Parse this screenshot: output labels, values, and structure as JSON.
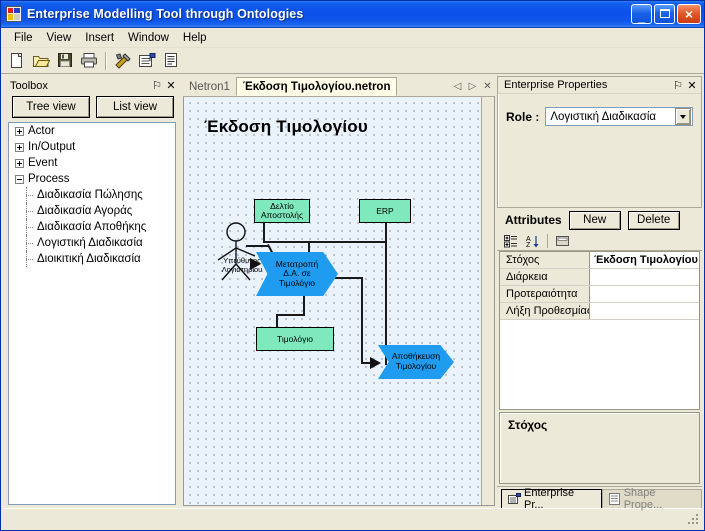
{
  "window": {
    "title": "Enterprise Modelling Tool through Ontologies",
    "icon": "app-icon",
    "minimize_label": "_",
    "maximize_label": "",
    "close_label": "×"
  },
  "menubar": {
    "items": [
      {
        "label": "File"
      },
      {
        "label": "View"
      },
      {
        "label": "Insert"
      },
      {
        "label": "Window"
      },
      {
        "label": "Help"
      }
    ]
  },
  "toolbar": {
    "buttons": [
      {
        "name": "new-file-icon",
        "tooltip": "New"
      },
      {
        "name": "open-folder-icon",
        "tooltip": "Open"
      },
      {
        "name": "save-disk-icon",
        "tooltip": "Save"
      },
      {
        "name": "print-icon",
        "tooltip": "Print"
      },
      {
        "name": "tools-icon",
        "tooltip": "Tools"
      },
      {
        "name": "properties-icon",
        "tooltip": "Properties"
      },
      {
        "name": "list-icon",
        "tooltip": "List"
      }
    ]
  },
  "toolbox": {
    "caption": "Toolbox",
    "pin_glyph": "⚐",
    "close_glyph": "✕",
    "tree_view_label": "Tree view",
    "list_view_label": "List view",
    "tree": [
      {
        "label": "Actor",
        "level": 0,
        "expanded": false
      },
      {
        "label": "In/Output",
        "level": 0,
        "expanded": false
      },
      {
        "label": "Event",
        "level": 0,
        "expanded": false
      },
      {
        "label": "Process",
        "level": 0,
        "expanded": true
      },
      {
        "label": "Διαδικασία Πώλησης",
        "level": 1
      },
      {
        "label": "Διαδικασία Αγοράς",
        "level": 1
      },
      {
        "label": "Διαδικασία Αποθήκης",
        "level": 1
      },
      {
        "label": "Λογιστική Διαδικασία",
        "level": 1
      },
      {
        "label": "Διοικιτική Διαδικασία",
        "level": 1
      }
    ]
  },
  "document": {
    "tabs": [
      {
        "label": "Netron1",
        "active": false
      },
      {
        "label": "Έκδοση Τιμολογίου.netron",
        "active": true
      }
    ],
    "nav_prev": "◁",
    "nav_next": "▷",
    "nav_close": "✕"
  },
  "diagram": {
    "title": "Έκδοση Τιμολογίου",
    "canvas_bg": "#eaf2fb",
    "box_fill": "#7fe8bd",
    "arrow_fill": "#1f9cf0",
    "actor_label": "Υπεύθυνος\nΛογιστηρίου",
    "actor_label_line1": "Υπεύθυνος",
    "actor_label_line2": "Λογιστηρίου",
    "nodes": [
      {
        "id": "deltio",
        "type": "box",
        "label": "Δελτίο\nΑποστολής"
      },
      {
        "id": "erp",
        "type": "box",
        "label": "ERP"
      },
      {
        "id": "metatropi",
        "type": "arrow",
        "label": "Μετατροπή\nΔ.Α. σε\nΤιμολόγιο"
      },
      {
        "id": "timologio",
        "type": "box",
        "label": "Τιμολόγιο"
      },
      {
        "id": "apothikeusi",
        "type": "arrow",
        "label": "Αποθήκευση\nΤιμολογίου"
      }
    ],
    "node_text": {
      "deltio_l1": "Δελτίο",
      "deltio_l2": "Αποστολής",
      "erp": "ERP",
      "metatropi_l1": "Μετατροπή",
      "metatropi_l2": "Δ.Α. σε",
      "metatropi_l3": "Τιμολόγιο",
      "timologio": "Τιμολόγιο",
      "apothikeusi_l1": "Αποθήκευση",
      "apothikeusi_l2": "Τιμολογίου"
    }
  },
  "properties": {
    "caption": "Enterprise Properties",
    "pin_glyph": "⚐",
    "close_glyph": "✕",
    "role_label": "Role :",
    "role_value": "Λογιστική Διαδικασία",
    "attributes_label": "Attributes",
    "new_button": "New",
    "delete_button": "Delete",
    "grid_toolbar": [
      {
        "name": "categorized-icon"
      },
      {
        "name": "sort-az-icon"
      },
      {
        "name": "property-pages-icon"
      }
    ],
    "rows": [
      {
        "name": "Στόχος",
        "value": "Έκδοση Τιμολογίου",
        "header": true
      },
      {
        "name": "Διάρκεια",
        "value": "",
        "header": false
      },
      {
        "name": "Προτεραιότητα",
        "value": "",
        "header": false
      },
      {
        "name": "Λήξη Προθεσμίας",
        "value": "",
        "header": false
      }
    ],
    "description_title": "Στόχος",
    "dock_tabs": [
      {
        "label": "Enterprise Pr...",
        "icon": "properties-icon",
        "active": true
      },
      {
        "label": "Shape Prope...",
        "icon": "list-icon",
        "active": false
      }
    ]
  }
}
